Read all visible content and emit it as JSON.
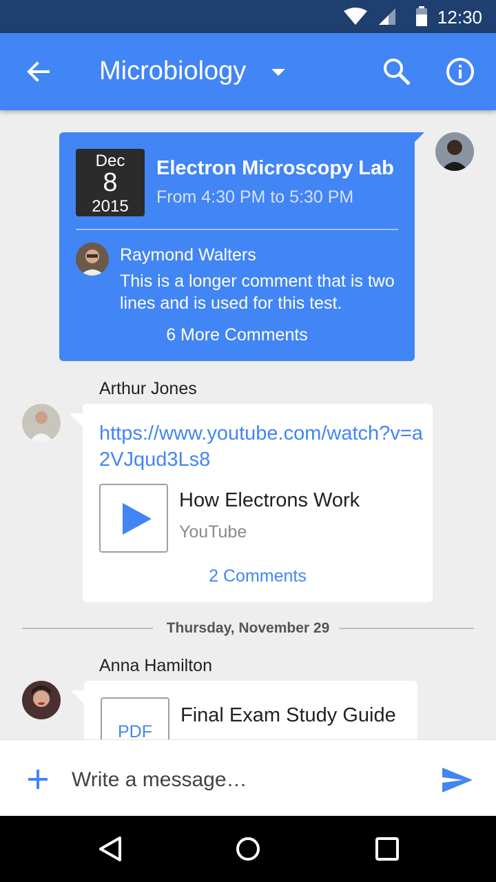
{
  "status_bar": {
    "time": "12:30"
  },
  "app_bar": {
    "title": "Microbiology"
  },
  "event": {
    "date_month": "Dec",
    "date_day": "8",
    "date_year": "2015",
    "title": "Electron Microscopy Lab",
    "time_range": "From 4:30 PM to 5:30 PM",
    "comment_author": "Raymond Walters",
    "comment_text": "This is a longer comment that is two lines and is used for this test.",
    "more_comments": "6 More Comments"
  },
  "message_1": {
    "sender": "Arthur Jones",
    "url": "https://www.youtube.com/watch?v=a2VJqud3Ls8",
    "video_title": "How Electrons Work",
    "video_source": "YouTube",
    "comments": "2 Comments"
  },
  "date_separator": "Thursday, November 29",
  "message_2": {
    "sender": "Anna Hamilton",
    "file_type": "PDF",
    "file_title": "Final Exam Study Guide"
  },
  "composer": {
    "placeholder": "Write a message…"
  },
  "colors": {
    "primary": "#4285f4",
    "status_bar": "#1e3f70",
    "background": "#eeeeee"
  },
  "icons": [
    "wifi-icon",
    "signal-icon",
    "battery-icon",
    "back-arrow-icon",
    "dropdown-icon",
    "search-icon",
    "info-icon",
    "play-icon",
    "plus-icon",
    "send-icon",
    "nav-back-icon",
    "nav-home-icon",
    "nav-recents-icon"
  ]
}
